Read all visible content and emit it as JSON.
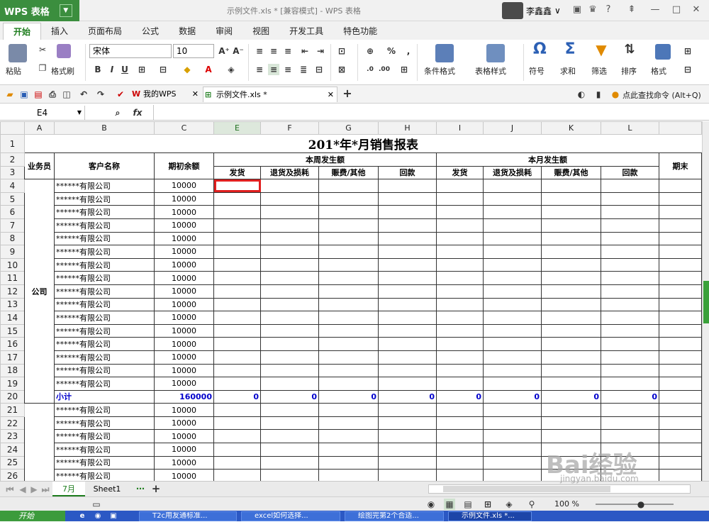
{
  "app": {
    "logo": "WPS 表格",
    "doc_title": "示例文件.xls * [兼容模式] - WPS 表格",
    "user": "李鑫鑫"
  },
  "menu_tabs": [
    "开始",
    "插入",
    "页面布局",
    "公式",
    "数据",
    "审阅",
    "视图",
    "开发工具",
    "特色功能"
  ],
  "ribbon": {
    "paste": "粘贴",
    "format_painter": "格式刷",
    "font_name": "宋体",
    "font_size": "10",
    "cond_format": "条件格式",
    "table_style": "表格样式",
    "symbol": "符号",
    "sum": "求和",
    "filter": "筛选",
    "sort": "排序",
    "format": "格式"
  },
  "doc_tabs": [
    {
      "label": "我的WPS"
    },
    {
      "label": "示例文件.xls *"
    }
  ],
  "search_cmd": "点此查找命令 (Alt+Q)",
  "formula_bar": {
    "cell_ref": "E4",
    "fx": "fx"
  },
  "columns": [
    "A",
    "B",
    "C",
    "E",
    "F",
    "G",
    "H",
    "I",
    "J",
    "K",
    "L"
  ],
  "sheet": {
    "title": "201*年*月销售报表",
    "h_salesman": "业务员",
    "h_customer": "客户名称",
    "h_opening": "期初余额",
    "h_week": "本周发生额",
    "h_month": "本月发生额",
    "h_end": "期末",
    "sub": [
      "发货",
      "退货及损耗",
      "赈费/其他",
      "回款"
    ],
    "group": "公司",
    "customer": "******有限公司",
    "opening": "10000",
    "subtotal_label": "小计",
    "subtotal_opening": "160000",
    "subtotal_zero": "0"
  },
  "sheet_tabs": [
    "7月",
    "Sheet1"
  ],
  "status": {
    "zoom": "100 %"
  },
  "taskbar": {
    "start": "开始",
    "items": [
      "T2c用友通标准...",
      "excel如何选择...",
      "绘图完第2个合适...",
      "示例文件.xls *..."
    ]
  },
  "watermark": {
    "brand": "Bai经验",
    "url": "jingyan.baidu.com"
  }
}
